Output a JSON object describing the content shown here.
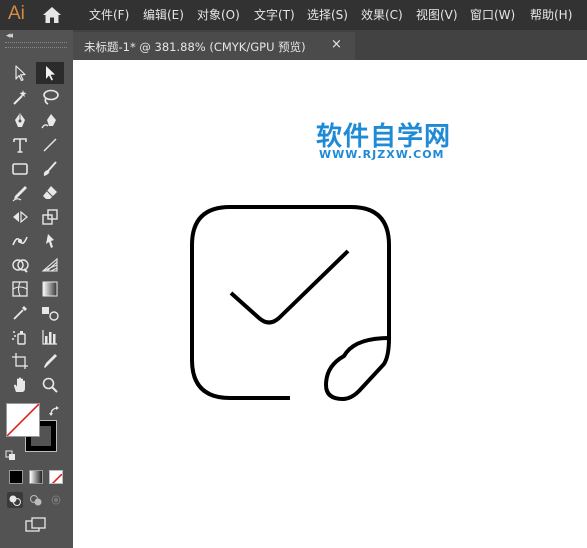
{
  "app": {
    "logo": "Ai"
  },
  "menu": [
    "文件(F)",
    "编辑(E)",
    "对象(O)",
    "文字(T)",
    "选择(S)",
    "效果(C)",
    "视图(V)",
    "窗口(W)",
    "帮助(H)"
  ],
  "toolbar": {
    "collapse_label": "◂◂"
  },
  "document_tab": {
    "title": "未标题-1* @ 381.88% (CMYK/GPU 预览)",
    "close_label": "×"
  },
  "watermark": {
    "title": "软件自学网",
    "url": "WWW.RJZXW.COM"
  },
  "colors": {
    "menubar": "#323232",
    "panel": "#535353",
    "canvas": "#ffffff",
    "accent": "#1f8ad6",
    "logo": "#d58a45"
  },
  "icons": [
    "home-icon",
    "selection-tool-icon",
    "direct-selection-tool-icon",
    "magic-wand-tool-icon",
    "lasso-tool-icon",
    "pen-tool-icon",
    "curvature-tool-icon",
    "type-tool-icon",
    "line-tool-icon",
    "rectangle-tool-icon",
    "paintbrush-tool-icon",
    "shaper-tool-icon",
    "eraser-tool-icon",
    "rotate-tool-icon",
    "scale-tool-icon",
    "width-tool-icon",
    "free-transform-tool-icon",
    "shape-builder-tool-icon",
    "perspective-grid-tool-icon",
    "mesh-tool-icon",
    "gradient-tool-icon",
    "eyedropper-tool-icon",
    "blend-tool-icon",
    "symbol-sprayer-tool-icon",
    "column-graph-tool-icon",
    "artboard-tool-icon",
    "slice-tool-icon",
    "hand-tool-icon",
    "zoom-tool-icon",
    "fill-none-icon",
    "stroke-swatch-icon",
    "swap-fill-stroke-icon",
    "default-fill-stroke-icon",
    "color-mode-icon",
    "gradient-mode-icon",
    "none-mode-icon",
    "draw-normal-icon",
    "draw-behind-icon",
    "draw-inside-icon",
    "screen-mode-icon"
  ]
}
